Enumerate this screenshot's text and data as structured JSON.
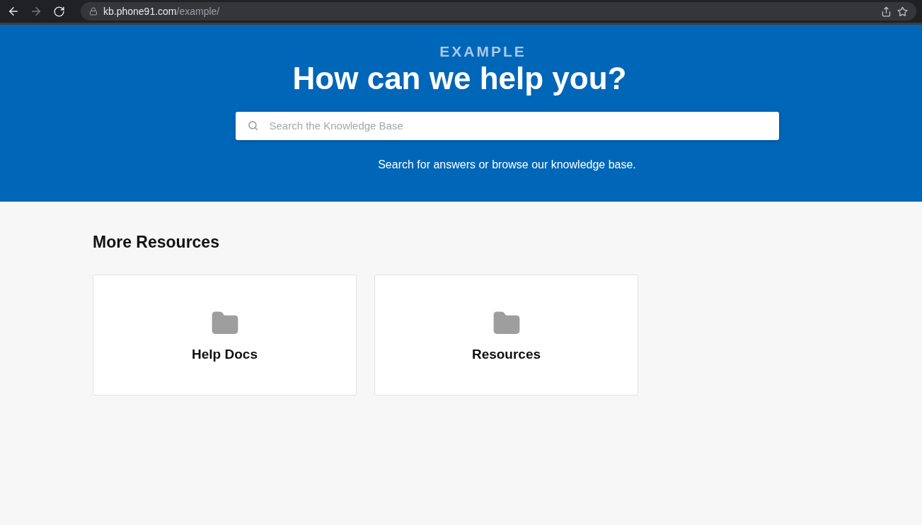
{
  "browser": {
    "url": {
      "host": "kb.phone91.com",
      "path": "/example/"
    },
    "forward_disabled": true
  },
  "hero": {
    "eyebrow": "EXAMPLE",
    "title": "How can we help you?",
    "search": {
      "placeholder": "Search the Knowledge Base"
    },
    "subtitle": "Search for answers or browse our knowledge base."
  },
  "section": {
    "title": "More Resources",
    "cards": [
      {
        "label": "Help Docs"
      },
      {
        "label": "Resources"
      }
    ]
  }
}
